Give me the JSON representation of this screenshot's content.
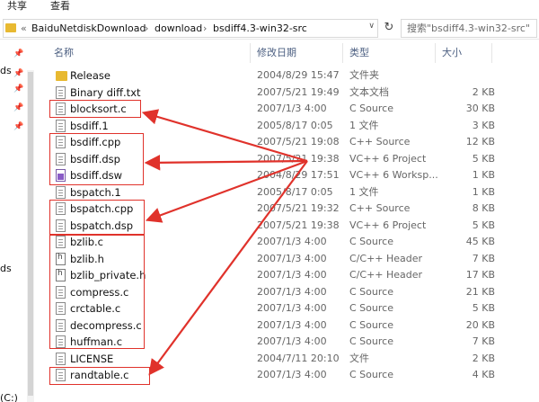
{
  "ribbon": {
    "share": "共享",
    "view": "查看"
  },
  "address": {
    "segments": [
      "BaiduNetdiskDownload",
      "download",
      "bsdiff4.3-win32-src"
    ],
    "prefix": "«",
    "separator": "›"
  },
  "search": {
    "placeholder": "搜索\"bsdiff4.3-win32-src\""
  },
  "nav": {
    "text1": "ds",
    "text2": "ds",
    "text3": "(C:)"
  },
  "columns": {
    "name": "名称",
    "date": "修改日期",
    "type": "类型",
    "size": "大小"
  },
  "files": [
    {
      "name": "Release",
      "date": "2004/8/29 15:47",
      "type": "文件夹",
      "size": "",
      "icon": "folder-icon"
    },
    {
      "name": "Binary diff.txt",
      "date": "2007/5/21 19:49",
      "type": "文本文档",
      "size": "2 KB",
      "icon": "text-file-icon"
    },
    {
      "name": "blocksort.c",
      "date": "2007/1/3 4:00",
      "type": "C Source",
      "size": "30 KB",
      "icon": "c-file-icon"
    },
    {
      "name": "bsdiff.1",
      "date": "2005/8/17 0:05",
      "type": "1 文件",
      "size": "3 KB",
      "icon": "file-icon"
    },
    {
      "name": "bsdiff.cpp",
      "date": "2007/5/21 19:08",
      "type": "C++ Source",
      "size": "12 KB",
      "icon": "cpp-file-icon"
    },
    {
      "name": "bsdiff.dsp",
      "date": "2007/5/21 19:38",
      "type": "VC++ 6 Project",
      "size": "5 KB",
      "icon": "project-file-icon"
    },
    {
      "name": "bsdiff.dsw",
      "date": "2004/8/29 17:51",
      "type": "VC++ 6 Worksp...",
      "size": "1 KB",
      "icon": "workspace-file-icon"
    },
    {
      "name": "bspatch.1",
      "date": "2005/8/17 0:05",
      "type": "1 文件",
      "size": "1 KB",
      "icon": "file-icon"
    },
    {
      "name": "bspatch.cpp",
      "date": "2007/5/21 19:32",
      "type": "C++ Source",
      "size": "8 KB",
      "icon": "cpp-file-icon"
    },
    {
      "name": "bspatch.dsp",
      "date": "2007/5/21 19:38",
      "type": "VC++ 6 Project",
      "size": "5 KB",
      "icon": "project-file-icon"
    },
    {
      "name": "bzlib.c",
      "date": "2007/1/3 4:00",
      "type": "C Source",
      "size": "45 KB",
      "icon": "c-file-icon"
    },
    {
      "name": "bzlib.h",
      "date": "2007/1/3 4:00",
      "type": "C/C++ Header",
      "size": "7 KB",
      "icon": "header-file-icon"
    },
    {
      "name": "bzlib_private.h",
      "date": "2007/1/3 4:00",
      "type": "C/C++ Header",
      "size": "17 KB",
      "icon": "header-file-icon"
    },
    {
      "name": "compress.c",
      "date": "2007/1/3 4:00",
      "type": "C Source",
      "size": "21 KB",
      "icon": "c-file-icon"
    },
    {
      "name": "crctable.c",
      "date": "2007/1/3 4:00",
      "type": "C Source",
      "size": "5 KB",
      "icon": "c-file-icon"
    },
    {
      "name": "decompress.c",
      "date": "2007/1/3 4:00",
      "type": "C Source",
      "size": "20 KB",
      "icon": "c-file-icon"
    },
    {
      "name": "huffman.c",
      "date": "2007/1/3 4:00",
      "type": "C Source",
      "size": "7 KB",
      "icon": "c-file-icon"
    },
    {
      "name": "LICENSE",
      "date": "2004/7/11 20:10",
      "type": "文件",
      "size": "2 KB",
      "icon": "file-icon"
    },
    {
      "name": "randtable.c",
      "date": "2007/1/3 4:00",
      "type": "C Source",
      "size": "4 KB",
      "icon": "c-file-icon"
    }
  ],
  "annotation_color": "#e0322b"
}
